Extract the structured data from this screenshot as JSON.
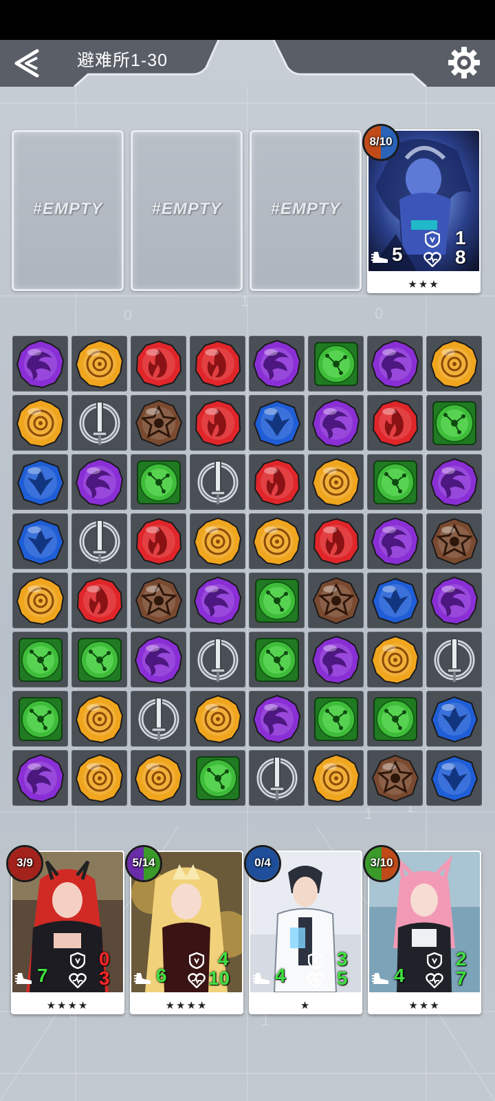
{
  "header": {
    "title": "避难所1-30"
  },
  "empty_slots": [
    "#EMPTY",
    "#EMPTY",
    "#EMPTY"
  ],
  "enemy": {
    "badge": "8/10",
    "move": "5",
    "defense": "1",
    "hp": "8",
    "stars": "★★★",
    "badge_colors": [
      "#c04a18",
      "#2a63b8"
    ]
  },
  "board": [
    [
      "purple",
      "yellow",
      "red",
      "red",
      "purple",
      "green",
      "purple",
      "yellow"
    ],
    [
      "yellow",
      "gray",
      "brown",
      "red",
      "blue",
      "purple",
      "red",
      "green"
    ],
    [
      "blue",
      "purple",
      "green",
      "gray",
      "red",
      "yellow",
      "green",
      "purple"
    ],
    [
      "blue",
      "gray",
      "red",
      "yellow",
      "yellow",
      "red",
      "purple",
      "brown"
    ],
    [
      "yellow",
      "red",
      "brown",
      "purple",
      "green",
      "brown",
      "blue",
      "purple"
    ],
    [
      "green",
      "green",
      "purple",
      "gray",
      "green",
      "purple",
      "yellow",
      "gray"
    ],
    [
      "green",
      "yellow",
      "gray",
      "yellow",
      "purple",
      "green",
      "green",
      "blue"
    ],
    [
      "purple",
      "yellow",
      "yellow",
      "green",
      "gray",
      "yellow",
      "brown",
      "blue"
    ]
  ],
  "heroes": [
    {
      "badge": "3/9",
      "move": "7",
      "defense": "0",
      "hp": "3",
      "stars": "★★★★",
      "badge_colors": [
        "#a3221b",
        "#a3221b"
      ],
      "stat_color": "#ff2626"
    },
    {
      "badge": "5/14",
      "move": "6",
      "defense": "4",
      "hp": "10",
      "stars": "★★★★",
      "badge_colors": [
        "#6a2ca8",
        "#3a9a2a"
      ],
      "stat_color": "#40e040"
    },
    {
      "badge": "0/4",
      "move": "4",
      "defense": "3",
      "hp": "5",
      "stars": "★",
      "badge_colors": [
        "#1f4f9a",
        "#1f4f9a"
      ],
      "stat_color": "#40e040"
    },
    {
      "badge": "3/10",
      "move": "4",
      "defense": "2",
      "hp": "7",
      "stars": "★★★",
      "badge_colors": [
        "#3a9a2a",
        "#c04a18"
      ],
      "stat_color": "#40e040"
    }
  ],
  "gem_colors": {
    "purple": "#8a2fd6",
    "yellow": "#f0a51e",
    "red": "#e0262a",
    "green": "#3fbd3a",
    "blue": "#1f5ed6",
    "brown": "#7a4a30",
    "gray": "#cfd3d8"
  },
  "icons": {
    "back": "back-arrow-icon",
    "settings": "gear-icon",
    "move": "boot-icon",
    "defense": "shield-icon",
    "hp": "heart-icon"
  }
}
